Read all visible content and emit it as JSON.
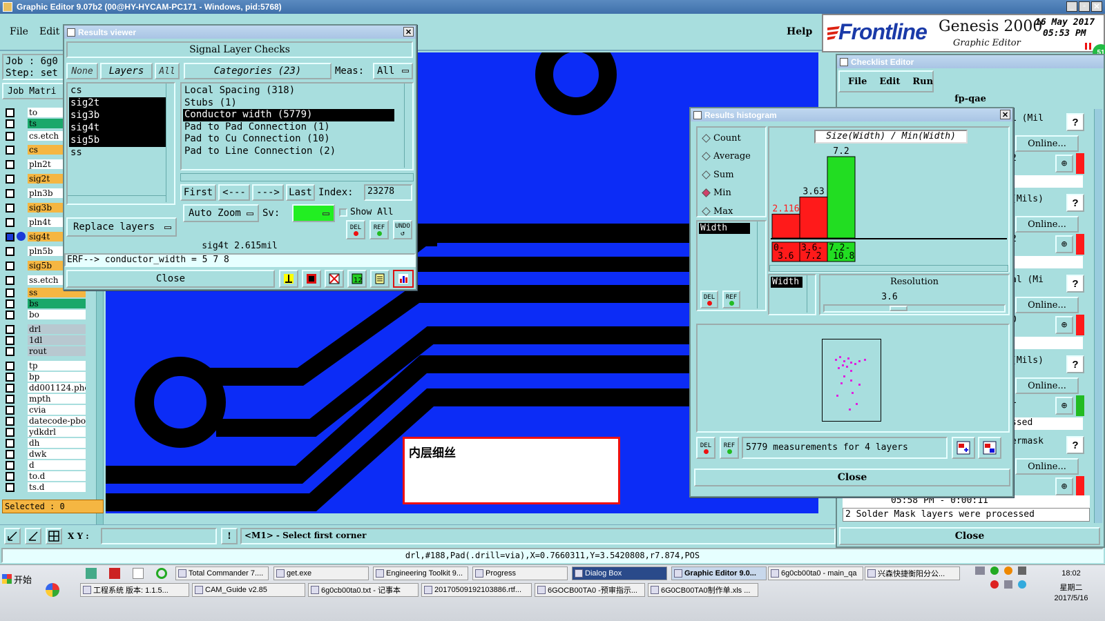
{
  "window": {
    "title": "Graphic Editor 9.07b2 (00@HY-HYCAM-PC171 - Windows, pid:5768)"
  },
  "menu": {
    "file": "File",
    "edit": "Edit",
    "help": "Help"
  },
  "brand": {
    "logo": "Frontline",
    "product": "Genesis 2000",
    "subtitle": "Graphic Editor",
    "date": "16 May 2017",
    "time": "05:53 PM"
  },
  "job": {
    "job_label": "Job : 6g0",
    "step_label": "Step: set",
    "matrix_btn": "Job Matri"
  },
  "layers": [
    {
      "name": "to",
      "color": "#ffffff"
    },
    {
      "name": "ts",
      "color": "#1aa86a"
    },
    {
      "name": "cs.etch",
      "color": "#ffffff"
    },
    {
      "name": "cs",
      "color": "#f5b642"
    },
    {
      "name": "pln2t",
      "color": "#ffffff"
    },
    {
      "name": "sig2t",
      "color": "#f5b642"
    },
    {
      "name": "pln3b",
      "color": "#ffffff"
    },
    {
      "name": "sig3b",
      "color": "#f5b642"
    },
    {
      "name": "pln4t",
      "color": "#ffffff"
    },
    {
      "name": "sig4t",
      "color": "#f5b642"
    },
    {
      "name": "pln5b",
      "color": "#ffffff"
    },
    {
      "name": "sig5b",
      "color": "#f5b642"
    },
    {
      "name": "ss.etch",
      "color": "#ffffff"
    },
    {
      "name": "ss",
      "color": "#f5b642"
    },
    {
      "name": "bs",
      "color": "#1aa86a"
    },
    {
      "name": "bo",
      "color": "#ffffff"
    },
    {
      "name": "drl",
      "color": "#b8c8d0"
    },
    {
      "name": "1dl",
      "color": "#b8c8d0"
    },
    {
      "name": "rout",
      "color": "#b8c8d0"
    },
    {
      "name": "tp",
      "color": "#ffffff"
    },
    {
      "name": "bp",
      "color": "#ffffff"
    },
    {
      "name": "dd001124.pho",
      "color": "#ffffff"
    },
    {
      "name": "mpth",
      "color": "#ffffff"
    },
    {
      "name": "cvia",
      "color": "#ffffff"
    },
    {
      "name": "datecode-pbo",
      "color": "#ffffff"
    },
    {
      "name": "ydkdrl",
      "color": "#ffffff"
    },
    {
      "name": "dh",
      "color": "#ffffff"
    },
    {
      "name": "dwk",
      "color": "#ffffff"
    },
    {
      "name": "d",
      "color": "#ffffff"
    },
    {
      "name": "to.d",
      "color": "#ffffff"
    },
    {
      "name": "ts.d",
      "color": "#ffffff"
    }
  ],
  "selected_label": "Selected : 0",
  "bottom_bar": {
    "xy_label": "X Y :",
    "xy_value": "",
    "prompt": "<M1> - Select first corner"
  },
  "status_line": "drl,#188,Pad(.drill=via),X=0.7660311,Y=3.5420808,r7.874,POS",
  "annotation": "内层细丝",
  "results_viewer": {
    "title": "Results viewer",
    "heading": "Signal Layer Checks",
    "none_btn": "None",
    "layers_btn": "Layers",
    "all_btn": "All",
    "categories_btn": "Categories (23)",
    "meas_label": "Meas:",
    "meas_value": "All",
    "layer_list": [
      "cs",
      "sig2t",
      "sig3b",
      "sig4t",
      "sig5b",
      "ss"
    ],
    "categories": [
      "Local Spacing (318)",
      "Stubs (1)",
      "Conductor width (5779)",
      "Pad to Pad Connection (1)",
      "Pad to Cu Connection (10)",
      "Pad to Line Connection (2)"
    ],
    "first_btn": "First",
    "prev_btn": "<---",
    "next_btn": "--->",
    "last_btn": "Last",
    "index_label": "Index:",
    "index_value": "23278",
    "autozoom_btn": "Auto Zoom",
    "sv_label": "Sv:",
    "show_all": "Show All",
    "replace_btn": "Replace layers",
    "del_lbl": "DEL",
    "ref_lbl": "REF",
    "undo_lbl": "UNDO",
    "info_line": "sig4t 2.615mil",
    "erf_line": "ERF--> conductor_width = 5 7 8",
    "close_btn": "Close"
  },
  "histogram": {
    "title": "Results histogram",
    "options": [
      "Count",
      "Average",
      "Sum",
      "Min",
      "Max"
    ],
    "selected_option": "Min",
    "field_list": [
      "Width"
    ],
    "chart_title": "Size(Width) / Min(Width)",
    "del_lbl": "DEL",
    "ref_lbl": "REF",
    "width_item": "Width",
    "resolution_label": "Resolution",
    "resolution_value": "3.6",
    "measurements": "5779 measurements for 4 layers",
    "close_btn": "Close"
  },
  "chart_data": {
    "type": "bar",
    "title": "Size(Width) / Min(Width)",
    "categories": [
      "0-3.6",
      "3.6-7.2",
      "7.2-10.8"
    ],
    "values": [
      2.116,
      3.63,
      7.2
    ],
    "value_labels": [
      "2.116",
      "3.63",
      "7.2"
    ],
    "category_labels": [
      [
        "0-",
        "3.6"
      ],
      [
        "3.6-",
        "7.2"
      ],
      [
        "7.2-",
        "10.8"
      ]
    ],
    "colors": [
      "#ff1a1a",
      "#ff1a1a",
      "#22dd22"
    ],
    "label_colors": [
      "#ff1a1a",
      "#000000",
      "#000000"
    ],
    "ylim": [
      0,
      8
    ],
    "grid": false
  },
  "checklist": {
    "title": "Checklist Editor",
    "menu": [
      "File",
      "Edit",
      "Run"
    ],
    "name": "fp-qae",
    "rows": [
      {
        "top": "1 (Mil",
        "online": "Online...",
        "num": "2",
        "status": "#ff1a1a"
      },
      {
        "top": "(Mils)",
        "online": "Online...",
        "num": "2",
        "status": "#ff1a1a"
      },
      {
        "top": "al (Mi",
        "online": "Online...",
        "num": "0",
        "status": "#ff1a1a"
      },
      {
        "top": "(Mils)",
        "online": "Online...",
        "num": "1",
        "status": "#22bb22",
        "extra": "ssed"
      },
      {
        "top": "ermask",
        "online": "Online...",
        "num": "",
        "status": "#ff1a1a"
      }
    ],
    "log_line": "05:58 PM - 0:00:11",
    "log_msg": "2 Solder Mask layers were processed",
    "close_btn": "Close"
  },
  "taskbar": {
    "start": "开始",
    "row1": [
      "Total Commander 7....",
      "get.exe",
      "Engineering Toolkit 9...",
      "Progress",
      "Dialog Box",
      "Graphic Editor 9.0...",
      "6g0cb00ta0 - main_qa",
      "兴森快捷衡阳分公..."
    ],
    "row2": [
      "工程系统  版本: 1.1.5...",
      "CAM_Guide v2.85",
      "6g0cb00ta0.txt - 记事本",
      "20170509192103886.rtf...",
      "6GOCB00TA0 -预审指示...",
      "6G0CB00TA0制作单.xls ..."
    ],
    "clock_time": "18:02",
    "clock_day": "星期二",
    "clock_date": "2017/5/16"
  }
}
